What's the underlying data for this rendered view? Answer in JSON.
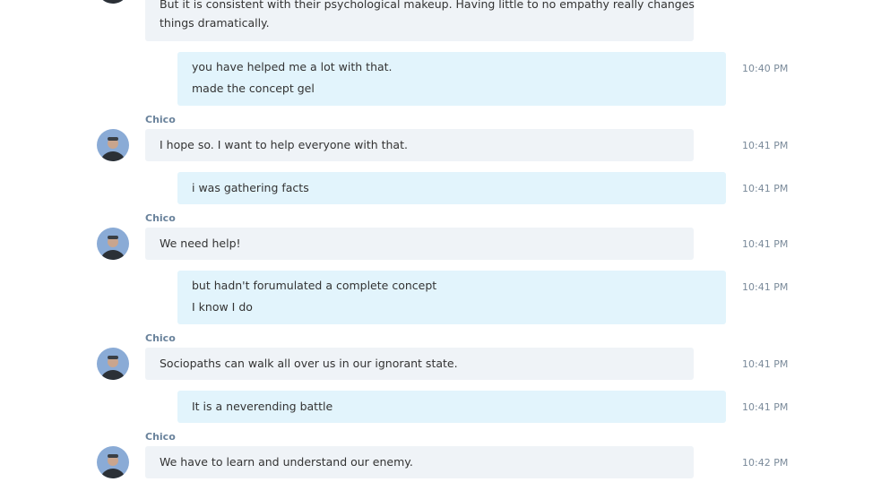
{
  "contact_name": "Chico",
  "messages": [
    {
      "direction": "in",
      "lines": [
        "But it is consistent with their psychological makeup.  Having little to no empathy really changes",
        "things dramatically."
      ]
    },
    {
      "direction": "out",
      "lines": [
        "you have helped me a lot with that.",
        "made the concept gel"
      ],
      "time": "10:40 PM"
    },
    {
      "direction": "in",
      "sender": "Chico",
      "lines": [
        "I hope so.  I want to help everyone with that."
      ],
      "time": "10:41 PM"
    },
    {
      "direction": "out",
      "lines": [
        "i was gathering facts"
      ],
      "time": "10:41 PM"
    },
    {
      "direction": "in",
      "sender": "Chico",
      "lines": [
        "We need help!"
      ],
      "time": "10:41 PM"
    },
    {
      "direction": "out",
      "lines": [
        "but hadn't forumulated a complete concept",
        "I know I do"
      ],
      "time": "10:41 PM"
    },
    {
      "direction": "in",
      "sender": "Chico",
      "lines": [
        "Sociopaths can walk all over us in our ignorant state."
      ],
      "time": "10:41 PM"
    },
    {
      "direction": "out",
      "lines": [
        "It is a neverending battle"
      ],
      "time": "10:41 PM"
    },
    {
      "direction": "in",
      "sender": "Chico",
      "lines": [
        "We have to learn and understand our enemy."
      ],
      "time": "10:42 PM"
    }
  ]
}
